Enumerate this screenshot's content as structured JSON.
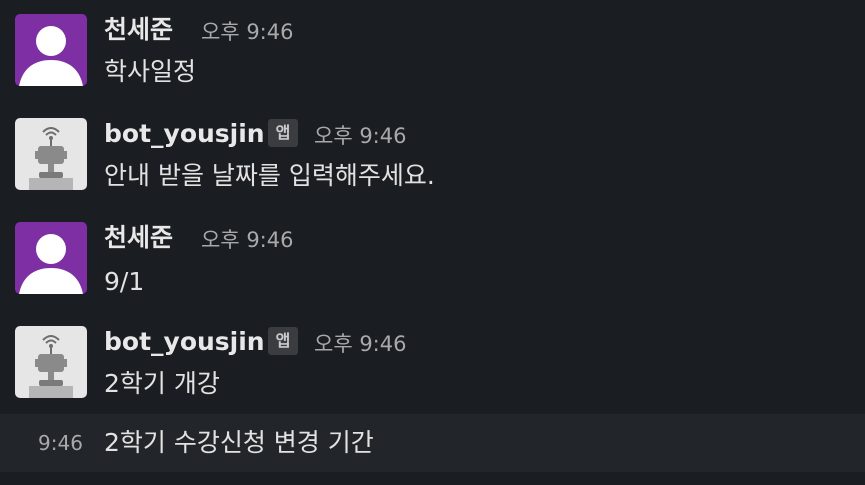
{
  "messages": [
    {
      "sender": "천세준",
      "time": "오후 9:46",
      "text": "학사일정",
      "avatar": "user-avatar",
      "is_app": false
    },
    {
      "sender": "bot_yousjin",
      "badge": "앱",
      "time": "오후 9:46",
      "text": "안내 받을 날짜를 입력해주세요.",
      "avatar": "robot-avatar",
      "is_app": true
    },
    {
      "sender": "천세준",
      "time": "오후 9:46",
      "text": "9/1",
      "avatar": "user-avatar",
      "is_app": false
    },
    {
      "sender": "bot_yousjin",
      "badge": "앱",
      "time": "오후 9:46",
      "text": "2학기 개강",
      "avatar": "robot-avatar",
      "is_app": true
    }
  ],
  "continuation": {
    "time": "9:46",
    "text": "2학기 수강신청 변경 기간"
  },
  "colors": {
    "background": "#1a1d21",
    "hover_background": "#222529",
    "user_avatar_bg": "#7e2fa3",
    "bot_avatar_bg": "#e6e6e6",
    "text": "#e2e2e2",
    "muted": "#a7a9ab"
  }
}
